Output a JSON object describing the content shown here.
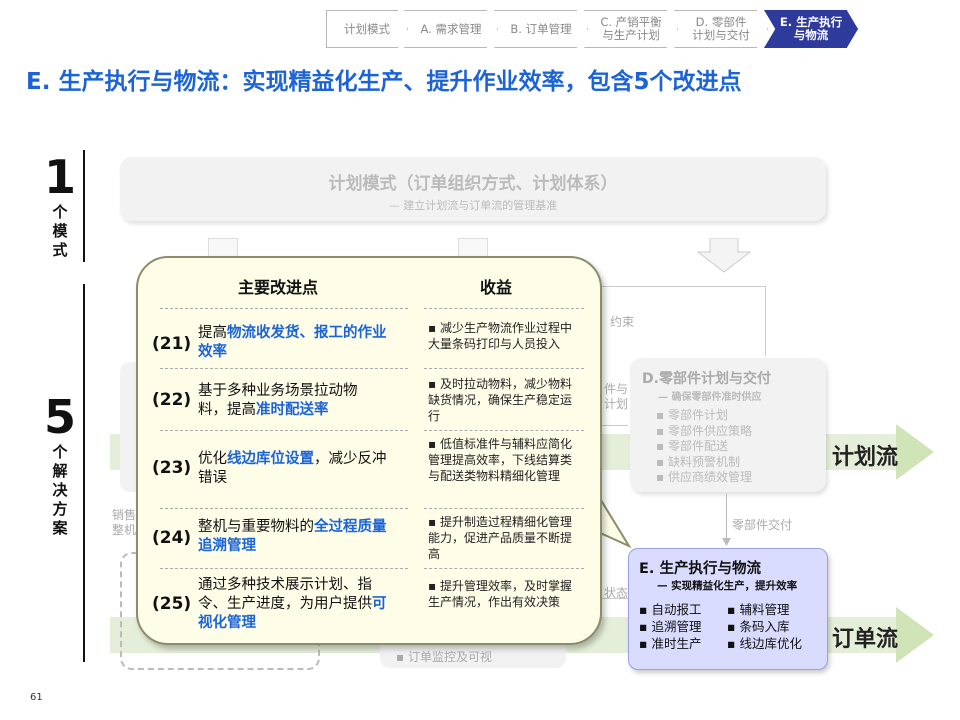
{
  "breadcrumb": [
    {
      "label": "计划模式"
    },
    {
      "label": "A. 需求管理"
    },
    {
      "label": "B. 订单管理"
    },
    {
      "label": "C. 产销平衡\n与生产计划"
    },
    {
      "label": "D. 零部件\n计划与交付"
    },
    {
      "label": "E. 生产执行\n与物流"
    }
  ],
  "title": "E. 生产执行与物流：实现精益化生产、提升作业效率，包含5个改进点",
  "side": {
    "one_num": "1",
    "one_text": "个模式",
    "five_num": "5",
    "five_text": "个解决方案"
  },
  "plan_box": {
    "title": "计划模式（订单组织方式、计划体系）",
    "subtitle": "— 建立计划流与订单流的管理基准"
  },
  "d_box": {
    "title": "D.零部件计划与交付",
    "subtitle": "— 确保零部件准时供应",
    "items": [
      "零部件计划",
      "零部件供应策略",
      "零部件配送",
      "缺料预警机制",
      "供应商绩效管理"
    ]
  },
  "flows": {
    "plan": "计划流",
    "order": "订单流"
  },
  "faint": {
    "constraint": "约束",
    "plan_fragment": "件与\n计划",
    "parts_delivery": "零部件交付",
    "status": "状态",
    "sales": "销售\n整机",
    "monitor": "▪ 订单监控及可视"
  },
  "e_box": {
    "title": "E. 生产执行与物流",
    "subtitle": "— 实现精益化生产，提升效率",
    "items_left": [
      "自动报工",
      "追溯管理",
      "准时生产"
    ],
    "items_right": [
      "辅料管理",
      "条码入库",
      "线边库优化"
    ]
  },
  "bubble": {
    "header_left": "主要改进点",
    "header_right": "收益",
    "rows": [
      {
        "num": "(21)",
        "pre": "提高",
        "hl": "物流收发货、报工的作业效率",
        "post": "",
        "benefit": "减少生产物流作业过程中大量条码打印与人员投入"
      },
      {
        "num": "(22)",
        "pre": "基于多种业务场景拉动物料，提高",
        "hl": "准时配送率",
        "post": "",
        "benefit": "及时拉动物料，减少物料缺货情况，确保生产稳定运行"
      },
      {
        "num": "(23)",
        "pre": "优化",
        "hl": "线边库位设置",
        "post": "，减少反冲错误",
        "benefit": "低值标准件与辅料应简化管理提高效率，下线结算类与配送类物料精细化管理"
      },
      {
        "num": "(24)",
        "pre": "整机与重要物料的",
        "hl": "全过程质量追溯管理",
        "post": "",
        "benefit": "提升制造过程精细化管理能力，促进产品质量不断提高"
      },
      {
        "num": "(25)",
        "pre": "通过多种技术展示计划、指令、生产进度，为用户提供",
        "hl": "可视化管理",
        "post": "",
        "benefit": "提升管理效率，及时掌握生产情况，作出有效决策"
      }
    ]
  },
  "page_number": "61"
}
